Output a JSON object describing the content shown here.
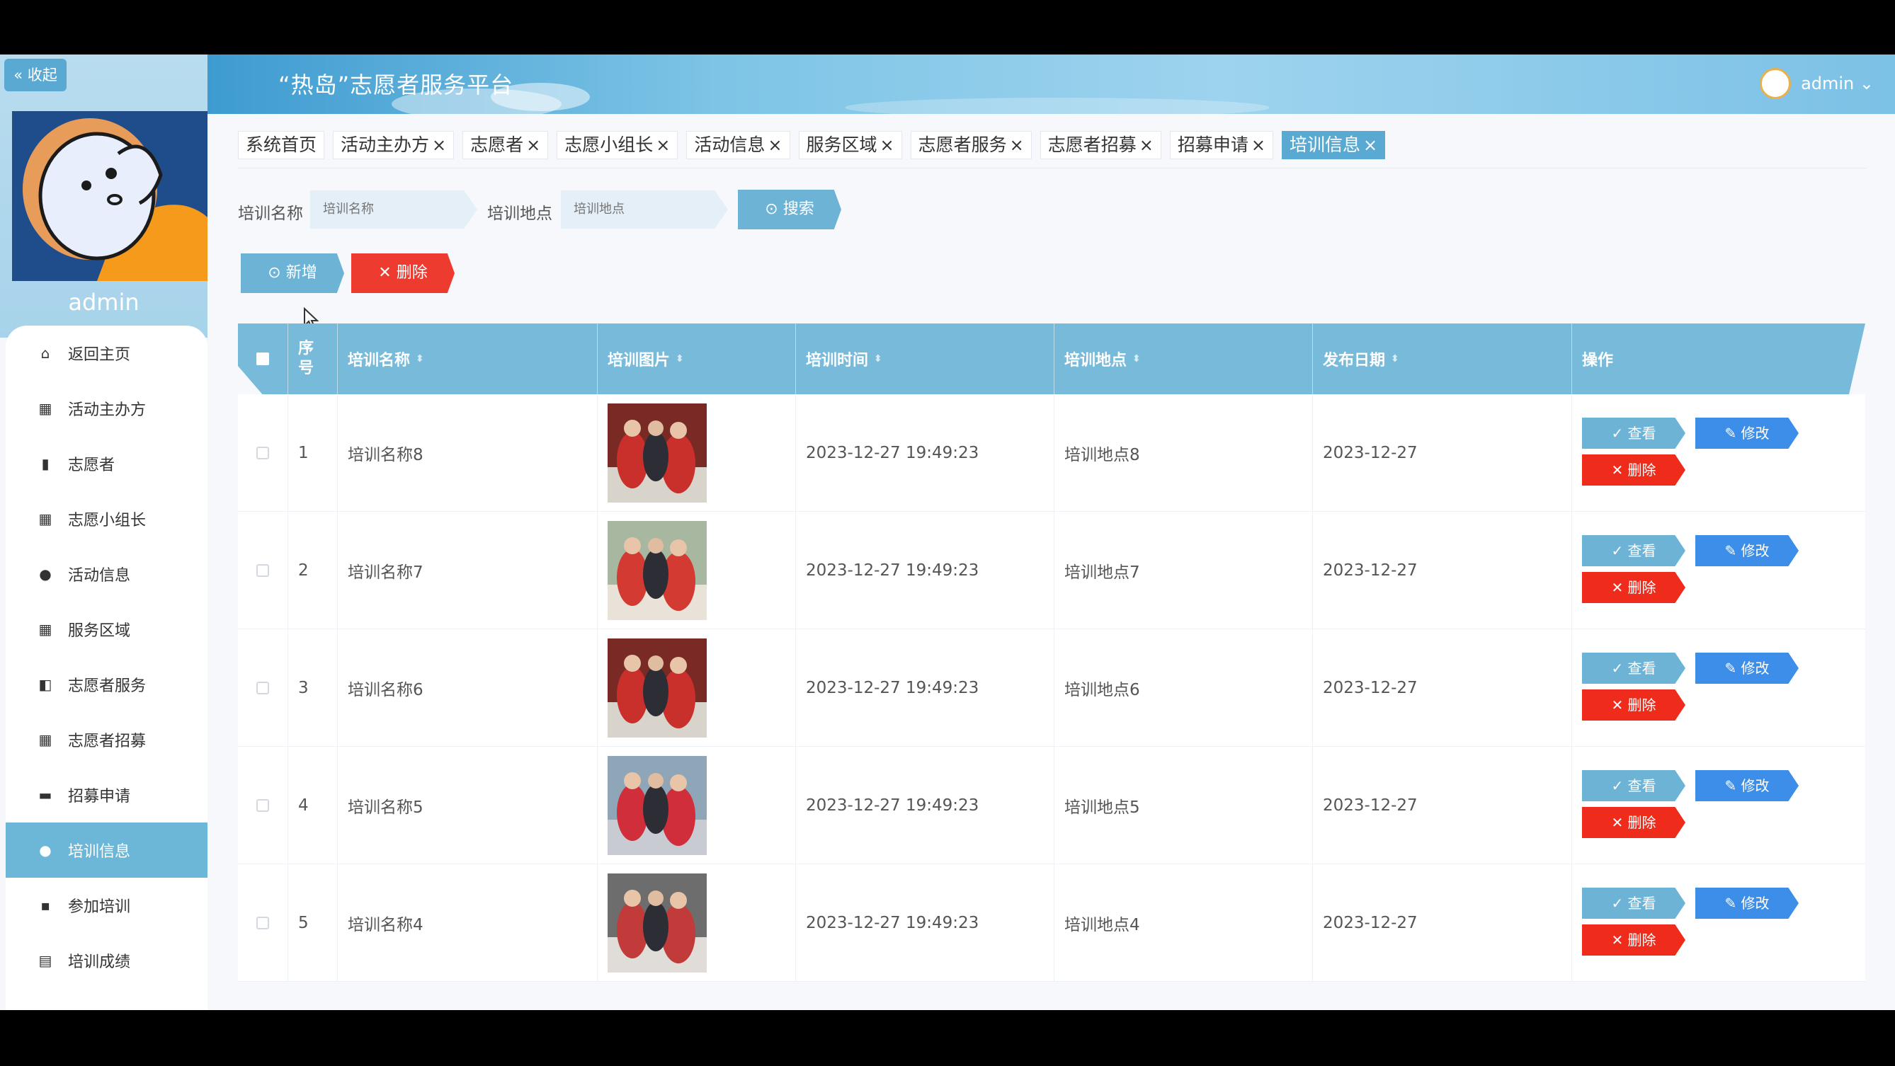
{
  "app": {
    "title": "“热岛”志愿者服务平台"
  },
  "sidebar": {
    "collapse_label": "« 收起",
    "username": "admin",
    "items": [
      {
        "label": "返回主页",
        "icon": "home-icon"
      },
      {
        "label": "活动主办方",
        "icon": "grid-icon"
      },
      {
        "label": "志愿者",
        "icon": "bar-chart-icon"
      },
      {
        "label": "志愿小组长",
        "icon": "grid-icon"
      },
      {
        "label": "活动信息",
        "icon": "location-pin-icon"
      },
      {
        "label": "服务区域",
        "icon": "grid-icon"
      },
      {
        "label": "志愿者服务",
        "icon": "layers-icon"
      },
      {
        "label": "志愿者招募",
        "icon": "grid-icon"
      },
      {
        "label": "招募申请",
        "icon": "briefcase-icon"
      },
      {
        "label": "培训信息",
        "icon": "user-icon"
      },
      {
        "label": "参加培训",
        "icon": "chat-icon"
      },
      {
        "label": "培训成绩",
        "icon": "clipboard-icon"
      }
    ],
    "active_index": 9
  },
  "header": {
    "user_label": "admin ⌄"
  },
  "tabs": [
    {
      "label": "系统首页",
      "closable": false
    },
    {
      "label": "活动主办方",
      "closable": true
    },
    {
      "label": "志愿者",
      "closable": true
    },
    {
      "label": "志愿小组长",
      "closable": true
    },
    {
      "label": "活动信息",
      "closable": true
    },
    {
      "label": "服务区域",
      "closable": true
    },
    {
      "label": "志愿者服务",
      "closable": true
    },
    {
      "label": "志愿者招募",
      "closable": true
    },
    {
      "label": "招募申请",
      "closable": true
    },
    {
      "label": "培训信息",
      "closable": true,
      "active": true
    }
  ],
  "search": {
    "name_label": "培训名称",
    "name_placeholder": "培训名称",
    "location_label": "培训地点",
    "location_placeholder": "培训地点",
    "search_button": "⊙ 搜索"
  },
  "actions": {
    "add_button": "⊙ 新增",
    "delete_button": "✕ 删除"
  },
  "table": {
    "columns": [
      "序号",
      "培训名称",
      "培训图片",
      "培训时间",
      "培训地点",
      "发布日期",
      "操作"
    ],
    "rows": [
      {
        "index": "1",
        "name": "培训名称8",
        "time": "2023-12-27 19:49:23",
        "location": "培训地点8",
        "date": "2023-12-27"
      },
      {
        "index": "2",
        "name": "培训名称7",
        "time": "2023-12-27 19:49:23",
        "location": "培训地点7",
        "date": "2023-12-27"
      },
      {
        "index": "3",
        "name": "培训名称6",
        "time": "2023-12-27 19:49:23",
        "location": "培训地点6",
        "date": "2023-12-27"
      },
      {
        "index": "4",
        "name": "培训名称5",
        "time": "2023-12-27 19:49:23",
        "location": "培训地点5",
        "date": "2023-12-27"
      },
      {
        "index": "5",
        "name": "培训名称4",
        "time": "2023-12-27 19:49:23",
        "location": "培训地点4",
        "date": "2023-12-27"
      }
    ],
    "row_actions": {
      "view": "✓ 查看",
      "edit": "✎ 修改",
      "delete": "✕ 删除"
    }
  },
  "colors": {
    "accent": "#5aa9d2",
    "danger": "#ee3b2f",
    "edit": "#3d8ee9",
    "table_header": "#78bad9"
  }
}
